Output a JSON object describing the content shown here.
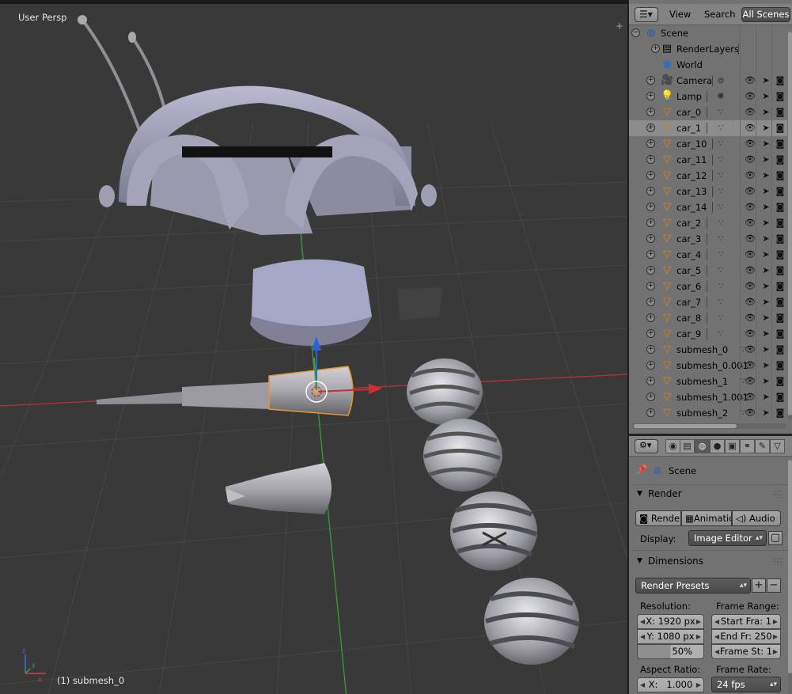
{
  "viewport": {
    "view_label": "User Persp",
    "object_label": "(1) submesh_0"
  },
  "outliner": {
    "header": {
      "menus": [
        "View",
        "Search"
      ],
      "display_mode": "All Scenes"
    },
    "scene": {
      "label": "Scene",
      "children": [
        {
          "label": "RenderLayers"
        },
        {
          "label": "World"
        }
      ]
    },
    "objects": [
      {
        "label": "Camera",
        "icon": "camera-icon"
      },
      {
        "label": "Lamp",
        "icon": "lamp-icon"
      },
      {
        "label": "car_0",
        "icon": "mesh-icon"
      },
      {
        "label": "car_1",
        "icon": "mesh-icon",
        "selected": true
      },
      {
        "label": "car_10",
        "icon": "mesh-icon"
      },
      {
        "label": "car_11",
        "icon": "mesh-icon"
      },
      {
        "label": "car_12",
        "icon": "mesh-icon"
      },
      {
        "label": "car_13",
        "icon": "mesh-icon"
      },
      {
        "label": "car_14",
        "icon": "mesh-icon"
      },
      {
        "label": "car_2",
        "icon": "mesh-icon"
      },
      {
        "label": "car_3",
        "icon": "mesh-icon"
      },
      {
        "label": "car_4",
        "icon": "mesh-icon"
      },
      {
        "label": "car_5",
        "icon": "mesh-icon"
      },
      {
        "label": "car_6",
        "icon": "mesh-icon"
      },
      {
        "label": "car_7",
        "icon": "mesh-icon"
      },
      {
        "label": "car_8",
        "icon": "mesh-icon"
      },
      {
        "label": "car_9",
        "icon": "mesh-icon"
      },
      {
        "label": "submesh_0",
        "icon": "mesh-icon"
      },
      {
        "label": "submesh_0.001",
        "icon": "mesh-icon"
      },
      {
        "label": "submesh_1",
        "icon": "mesh-icon"
      },
      {
        "label": "submesh_1.001",
        "icon": "mesh-icon"
      },
      {
        "label": "submesh_2",
        "icon": "mesh-icon"
      }
    ]
  },
  "properties": {
    "context_label": "Scene",
    "render": {
      "title": "Render",
      "buttons": [
        "Render",
        "Animatic",
        "Audio"
      ],
      "display_label": "Display:",
      "display_value": "Image Editor"
    },
    "dimensions": {
      "title": "Dimensions",
      "presets": "Render Presets",
      "resolution_label": "Resolution:",
      "res_x": "X: 1920 px",
      "res_y": "Y: 1080 px",
      "res_pct": "50%",
      "frame_range_label": "Frame Range:",
      "start": "Start Fra: 1",
      "end": "End Fr: 250",
      "step": "Frame St: 1",
      "aspect_label": "Aspect Ratio:",
      "aspect_x": "X:",
      "aspect_x_value": "1.000",
      "frame_rate_label": "Frame Rate:",
      "frame_rate": "24 fps"
    }
  },
  "colors": {
    "viewport_bg": "#393939",
    "panel_bg": "#727272",
    "x_axis": "#c8302f",
    "y_axis": "#3fa03a",
    "z_axis": "#2d5fd6",
    "selection": "#e8952f"
  }
}
